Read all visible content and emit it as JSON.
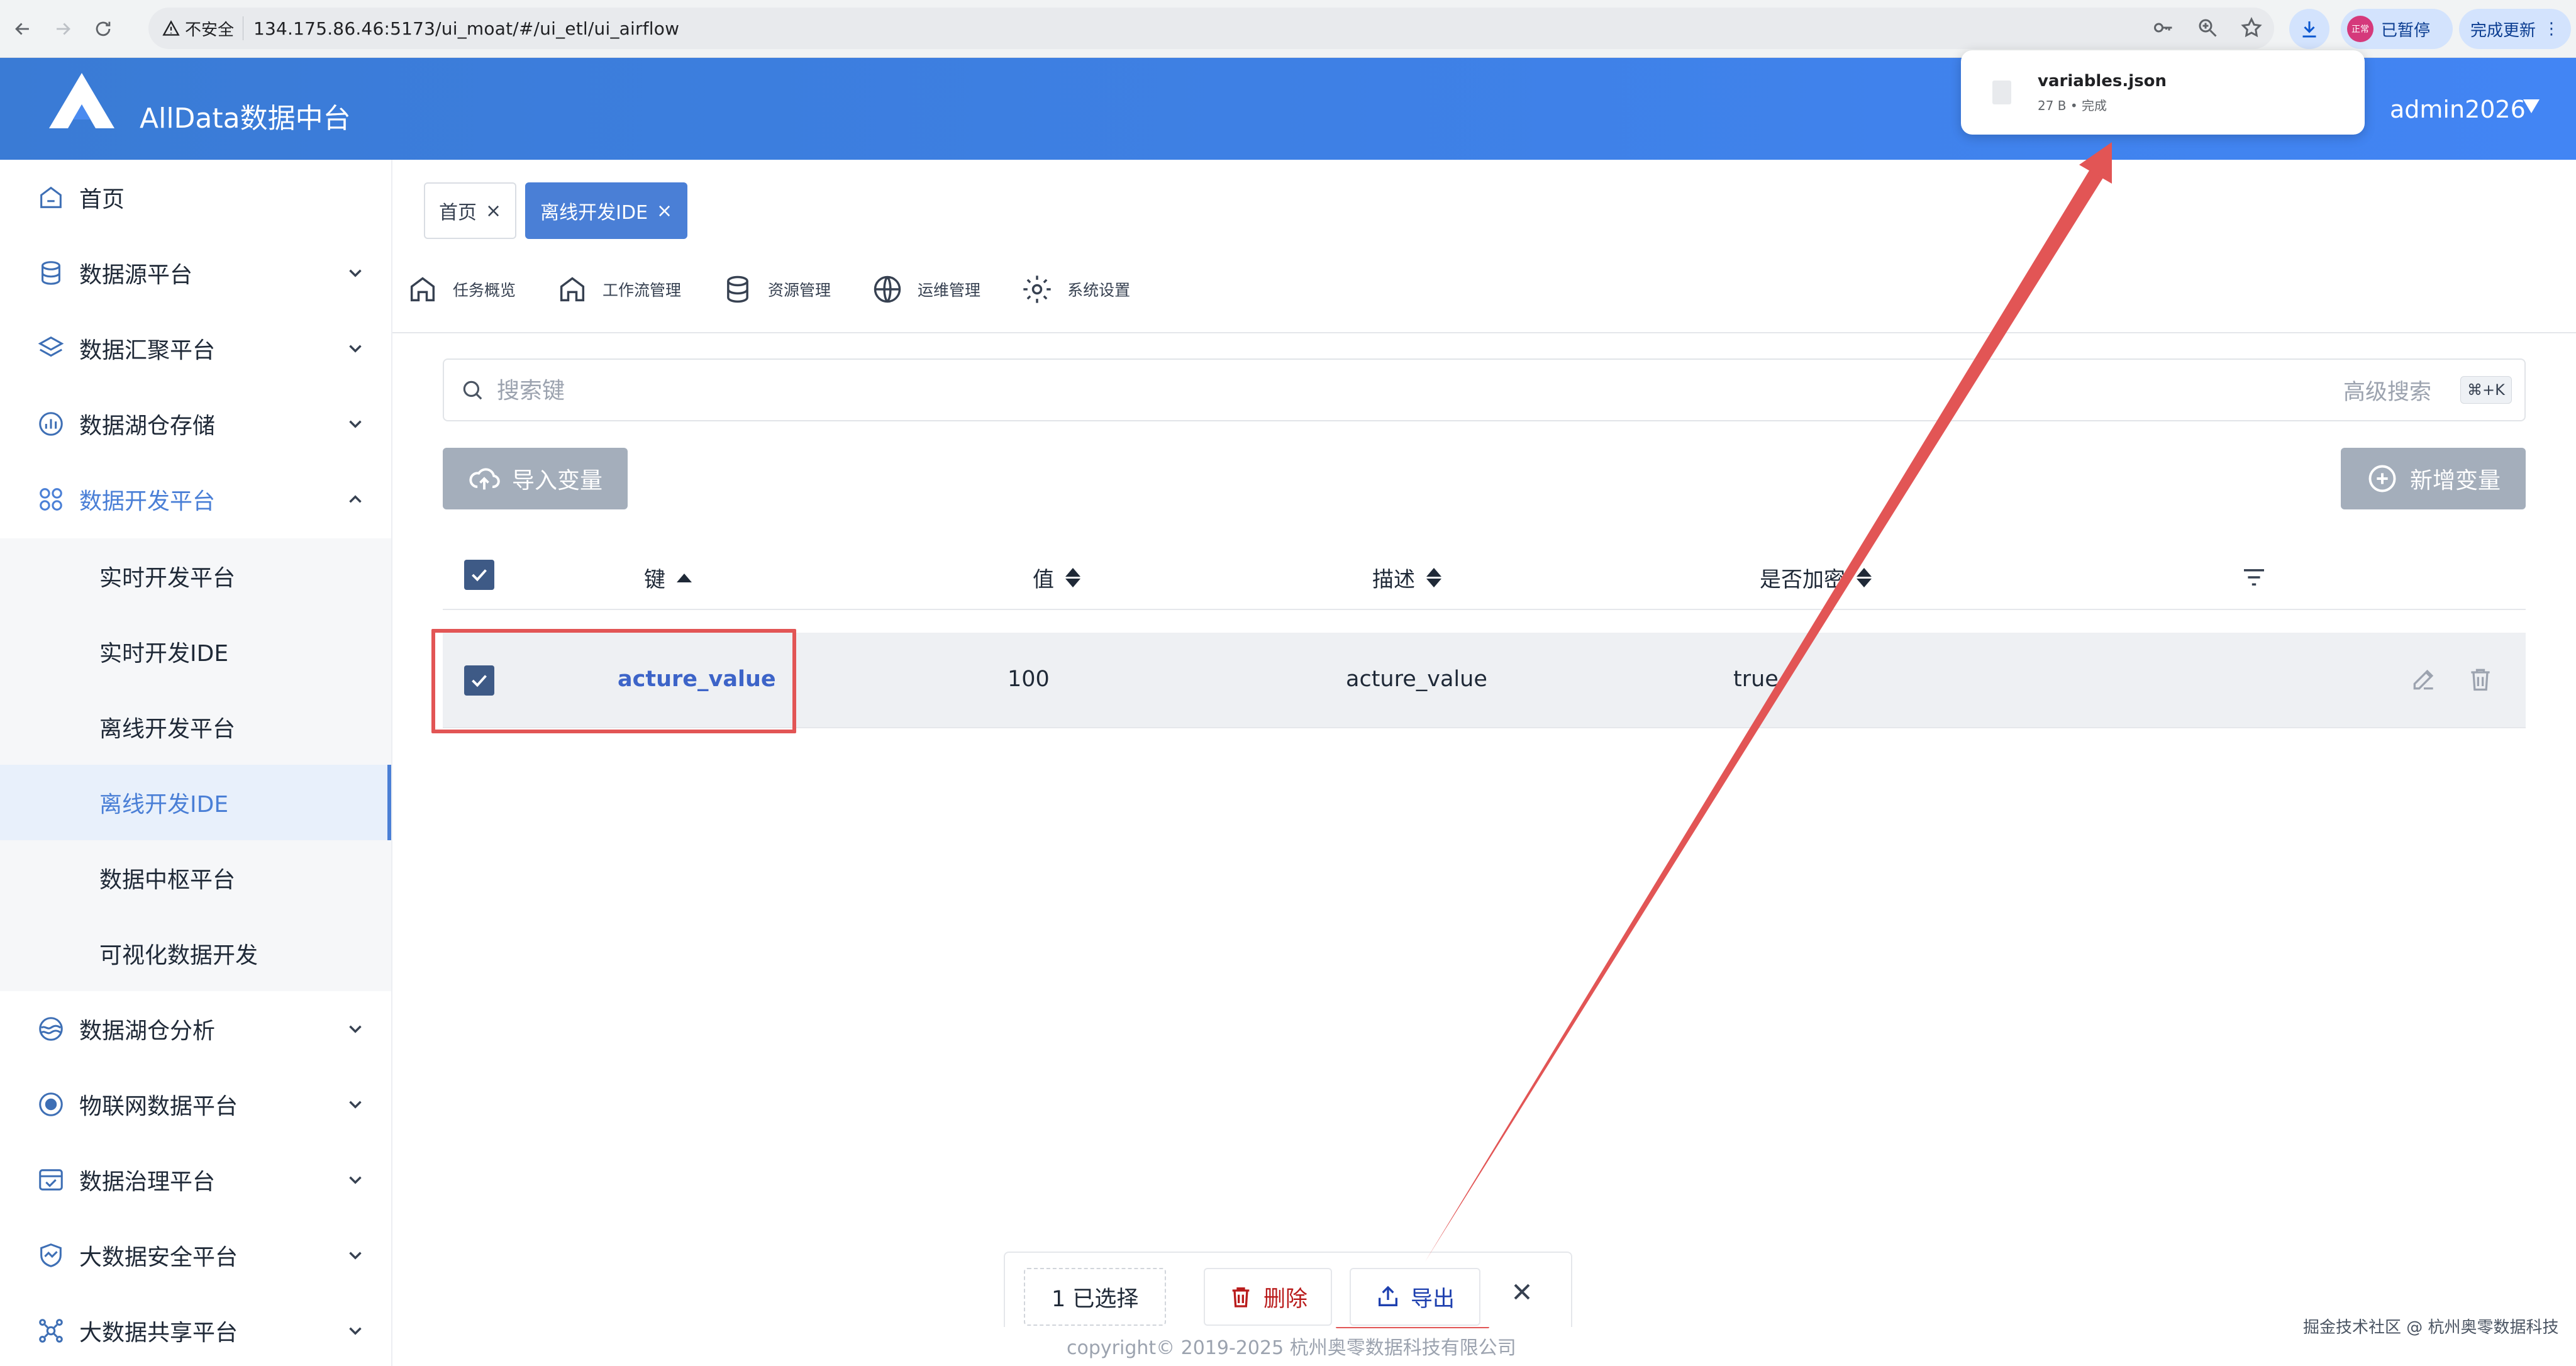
{
  "browser": {
    "security_label": "不安全",
    "url": "134.175.86.46:5173/ui_moat/#/ui_etl/ui_airflow",
    "paused_badge": "正常",
    "paused_label": "已暂停",
    "update_label": "完成更新"
  },
  "download": {
    "file_name": "variables.json",
    "status": "27 B • 完成"
  },
  "header": {
    "brand": "AllData数据中台",
    "user": "admin2026"
  },
  "sidebar": {
    "items": [
      {
        "label": "首页",
        "icon": "home-icon"
      },
      {
        "label": "数据源平台",
        "icon": "database-icon"
      },
      {
        "label": "数据汇聚平台",
        "icon": "layers-icon"
      },
      {
        "label": "数据湖仓存储",
        "icon": "chart-icon"
      },
      {
        "label": "数据开发平台",
        "icon": "apps-icon"
      },
      {
        "label": "数据湖仓分析",
        "icon": "lake-icon"
      },
      {
        "label": "物联网数据平台",
        "icon": "iot-icon"
      },
      {
        "label": "数据治理平台",
        "icon": "governance-icon"
      },
      {
        "label": "大数据安全平台",
        "icon": "security-icon"
      },
      {
        "label": "大数据共享平台",
        "icon": "share-icon"
      }
    ],
    "sub_items": [
      {
        "label": "实时开发平台"
      },
      {
        "label": "实时开发IDE"
      },
      {
        "label": "离线开发平台"
      },
      {
        "label": "离线开发IDE"
      },
      {
        "label": "数据中枢平台"
      },
      {
        "label": "可视化数据开发"
      }
    ]
  },
  "tabs": [
    {
      "label": "首页",
      "close": "×"
    },
    {
      "label": "离线开发IDE",
      "close": "×"
    }
  ],
  "toolbar": [
    {
      "label": "任务概览"
    },
    {
      "label": "工作流管理"
    },
    {
      "label": "资源管理"
    },
    {
      "label": "运维管理"
    },
    {
      "label": "系统设置"
    }
  ],
  "search": {
    "placeholder": "搜索键",
    "advanced": "高级搜索",
    "shortcut": "⌘+K"
  },
  "actions": {
    "import_label": "导入变量",
    "add_label": "新增变量"
  },
  "table": {
    "headers": {
      "key": "键",
      "value": "值",
      "description": "描述",
      "encrypted": "是否加密"
    },
    "rows": [
      {
        "key": "acture_value",
        "value": "100",
        "description": "acture_value",
        "encrypted": "true"
      }
    ]
  },
  "bottom_bar": {
    "selected": "1 已选择",
    "delete_label": "删除",
    "export_label": "导出"
  },
  "footer": {
    "copyright": "copyright© 2019-2025 杭州奥零数据科技有限公司",
    "watermark": "掘金技术社区 @ 杭州奥零数据科技"
  },
  "colors": {
    "header_blue": "#4285f4",
    "accent": "#4a7fd6",
    "annotation_red": "#e25555",
    "checkbox": "#3e5a86",
    "delete_red": "#b91c1c"
  }
}
